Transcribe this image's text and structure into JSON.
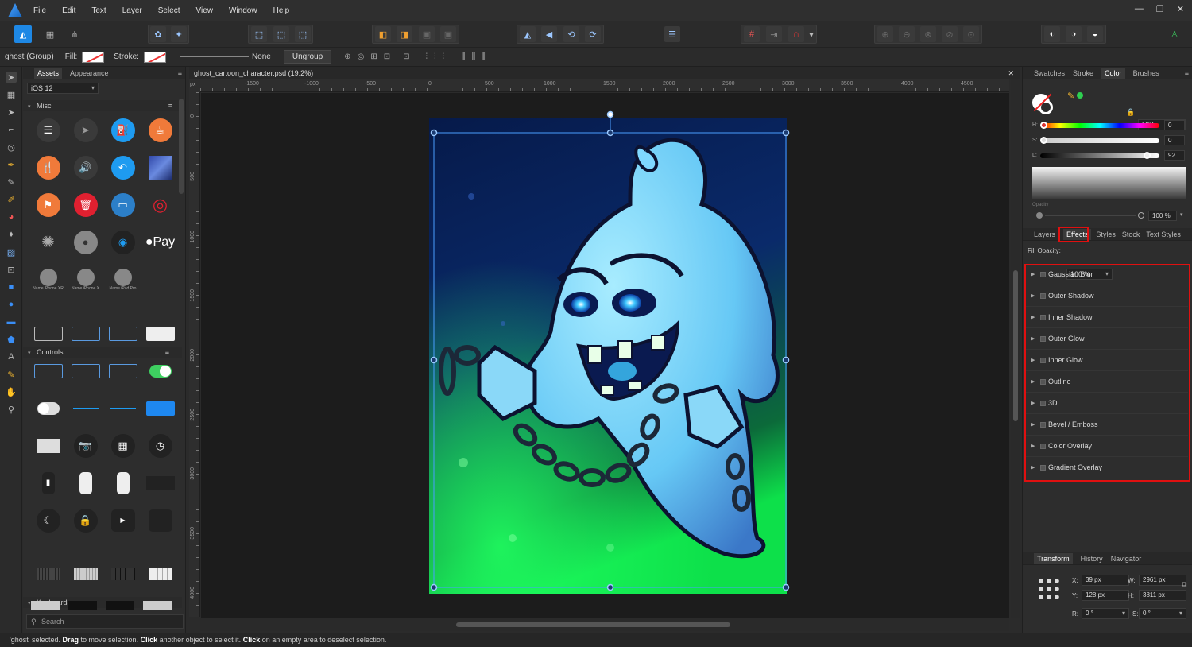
{
  "app": {
    "menu": [
      "File",
      "Edit",
      "Text",
      "Layer",
      "Select",
      "View",
      "Window",
      "Help"
    ]
  },
  "context": {
    "selection_label": "ghost (Group)",
    "fill_label": "Fill:",
    "stroke_label": "Stroke:",
    "stroke_width": "None",
    "ungroup_label": "Ungroup"
  },
  "assets_panel": {
    "tabs": [
      "Assets",
      "Appearance"
    ],
    "library": "iOS 12",
    "sections": [
      "Misc",
      "Controls",
      "Keyboards"
    ],
    "small_labels": [
      "Name iPhone XR",
      "Name iPhone X",
      "Name iPad Pro"
    ],
    "search_placeholder": "Search"
  },
  "document": {
    "title": "ghost_cartoon_character.psd (19.2%)",
    "ruler_x": [
      "-1500",
      "-1000",
      "-500",
      "0",
      "500",
      "1000",
      "1500",
      "2000",
      "2500",
      "3000",
      "3500",
      "4000",
      "4500"
    ],
    "ruler_y": [
      "0",
      "500",
      "1000",
      "1500",
      "2000",
      "2500",
      "3000",
      "3500",
      "4000"
    ],
    "ruler_unit": "px"
  },
  "color_panel": {
    "tabs": [
      "Swatches",
      "Stroke",
      "Color",
      "Brushes"
    ],
    "model": "HSL",
    "h_label": "H:",
    "s_label": "S:",
    "l_label": "L:",
    "h": "0",
    "s": "0",
    "l": "92",
    "opacity_label": "Opacity",
    "opacity": "100 %"
  },
  "effects_panel": {
    "tabs": [
      "Layers",
      "Effects",
      "Styles",
      "Stock",
      "Text Styles"
    ],
    "fill_opacity_label": "Fill Opacity:",
    "fill_opacity": "100 %",
    "effects": [
      "Gaussian Blur",
      "Outer Shadow",
      "Inner Shadow",
      "Outer Glow",
      "Inner Glow",
      "Outline",
      "3D",
      "Bevel / Emboss",
      "Color Overlay",
      "Gradient Overlay"
    ]
  },
  "transform_panel": {
    "tabs": [
      "Transform",
      "History",
      "Navigator"
    ],
    "x_label": "X:",
    "x": "39 px",
    "y_label": "Y:",
    "y": "128 px",
    "w_label": "W:",
    "w": "2961 px",
    "h_label": "H:",
    "h": "3811 px",
    "r_label": "R:",
    "r": "0 °",
    "s_label": "S:",
    "s": "0 °"
  },
  "status": {
    "part1": "'ghost' selected.",
    "drag": "Drag",
    "part2": "to move selection.",
    "click": "Click",
    "part3": "another object to select it.",
    "click2": "Click",
    "part4": "on an empty area to deselect selection."
  },
  "colors": {
    "accent": "#4a9eff",
    "highlight_box": "#e01010",
    "ghost_body": "#7fd8ff",
    "glow": "#1de05a"
  }
}
